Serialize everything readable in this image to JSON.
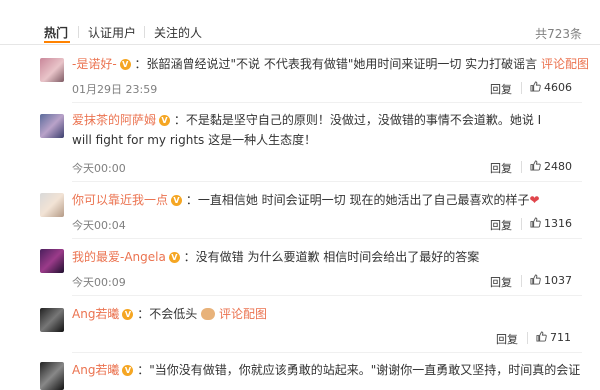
{
  "tabs": {
    "hot": "热门",
    "verified": "认证用户",
    "following": "关注的人"
  },
  "total_count": "共723条",
  "comments": [
    {
      "user": "-是诺好-",
      "text": "：张韶涵曾经说过\"不说 不代表我有做错\"她用时间来证明一切 实力打破谣言",
      "link": "评论配图",
      "time": "01月29日 23:59",
      "reply": "回复",
      "likes": "4606"
    },
    {
      "user": "爱抹茶的阿萨姆",
      "text": "：不是黏是坚守自己的原则！没做过，没做错的事情不会道歉。她说 I will fight for my rights 这是一种人生态度！",
      "time": "今天00:00",
      "reply": "回复",
      "likes": "2480"
    },
    {
      "user": "你可以靠近我一点",
      "text": "：一直相信她 时间会证明一切 现在的她活出了自己最喜欢的样子",
      "heart": "❤",
      "time": "今天00:04",
      "reply": "回复",
      "likes": "1316"
    },
    {
      "user": "我的最爱-Angela",
      "text": "：没有做错 为什么要道歉 相信时间会给出了最好的答案",
      "time": "今天00:09",
      "reply": "回复",
      "likes": "1037"
    },
    {
      "user": "Ang若曦",
      "text": "：不会低头",
      "link": "评论配图",
      "reply": "回复",
      "likes": "711"
    },
    {
      "user": "Ang若曦",
      "text": "：\"当你没有做错，你就应该勇敢的站起来。\"谢谢你一直勇敢又坚持，时间真的会证"
    }
  ],
  "colors": {
    "accent": "#ff8200",
    "link": "#eb7350",
    "muted": "#808080"
  }
}
